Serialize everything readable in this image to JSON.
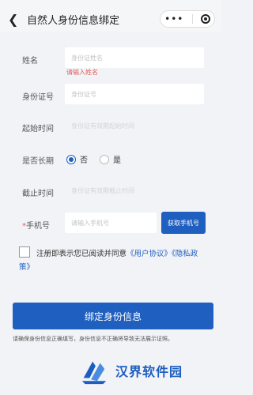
{
  "nav": {
    "title": "自然人身份信息绑定",
    "back_icon": "chevron-left-icon",
    "more_icon": "more-dots-icon",
    "close_icon": "target-close-icon"
  },
  "form": {
    "name": {
      "label": "姓名",
      "placeholder": "身份证姓名",
      "error": "请输入姓名"
    },
    "id_number": {
      "label": "身份证号",
      "placeholder": "身份证号"
    },
    "start_date": {
      "label": "起始时间",
      "placeholder": "身份证有效期起始时间"
    },
    "long_term": {
      "label": "是否长期",
      "options": [
        "否",
        "是"
      ],
      "selected": "否"
    },
    "end_date": {
      "label": "截止时间",
      "placeholder": "身份证有效期截止时间"
    },
    "phone": {
      "required_mark": "*",
      "label": "手机号",
      "placeholder": "请输入手机号",
      "button": "获取手机号"
    }
  },
  "agreement": {
    "prefix": "注册即表示您已阅读并同意",
    "user_agreement": "《用户协议》",
    "privacy_policy": "《隐私政策》"
  },
  "submit_label": "绑定身份信息",
  "notice": "请确保身份信息正确填写，身份信息不正确将导致无法展示证照。",
  "watermark_text": "汉界软件园",
  "colors": {
    "primary": "#1f5fbf",
    "error": "#e25a5a",
    "background": "#f1f3f6"
  }
}
